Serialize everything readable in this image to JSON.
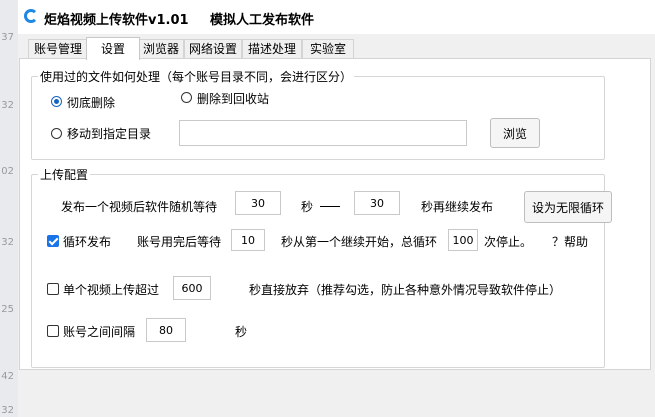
{
  "window": {
    "title": "炬焰视频上传软件v1.01",
    "subtitle": "模拟人工发布软件"
  },
  "left_strip": [
    "37",
    "32",
    "02",
    "32",
    "25",
    "42",
    "32"
  ],
  "tabs": [
    {
      "label": "账号管理",
      "active": false
    },
    {
      "label": "设置",
      "active": true
    },
    {
      "label": "浏览器",
      "active": false
    },
    {
      "label": "网络设置",
      "active": false
    },
    {
      "label": "描述处理",
      "active": false
    },
    {
      "label": "实验室",
      "active": false
    }
  ],
  "file_handling": {
    "legend": "使用过的文件如何处理（每个账号目录不同，会进行区分）",
    "option_delete": "彻底删除",
    "option_recycle": "删除到回收站",
    "option_move": "移动到指定目录",
    "selected": "彻底删除",
    "move_path": "",
    "browse_label": "浏览"
  },
  "upload_config": {
    "legend": "上传配置",
    "wait_prefix": "发布一个视频后软件随机等待",
    "wait_min": "30",
    "sec_label": "秒",
    "wait_max": "30",
    "wait_suffix": "秒再继续发布",
    "infinite_loop_button": "设为无限循环",
    "loop_publish_label": "循环发布",
    "loop_publish_checked": true,
    "account_done_wait_label": "账号用完后等待",
    "account_done_wait": "10",
    "loop_middle_label": "秒从第一个继续开始，总循环",
    "loop_count": "100",
    "loop_suffix": "次停止。",
    "help_label": "？帮助",
    "single_upload_label": "单个视频上传超过",
    "single_upload_checked": false,
    "single_upload_timeout": "600",
    "single_upload_suffix": "秒直接放弃（推荐勾选，防止各种意外情况导致软件停止）",
    "account_interval_label": "账号之间间隔",
    "account_interval_checked": false,
    "account_interval": "80",
    "account_interval_unit": "秒"
  },
  "colors": {
    "accent": "#1a73e8",
    "tab_active_bg": "#ffffff",
    "window_bg": "#f0f0f0"
  }
}
